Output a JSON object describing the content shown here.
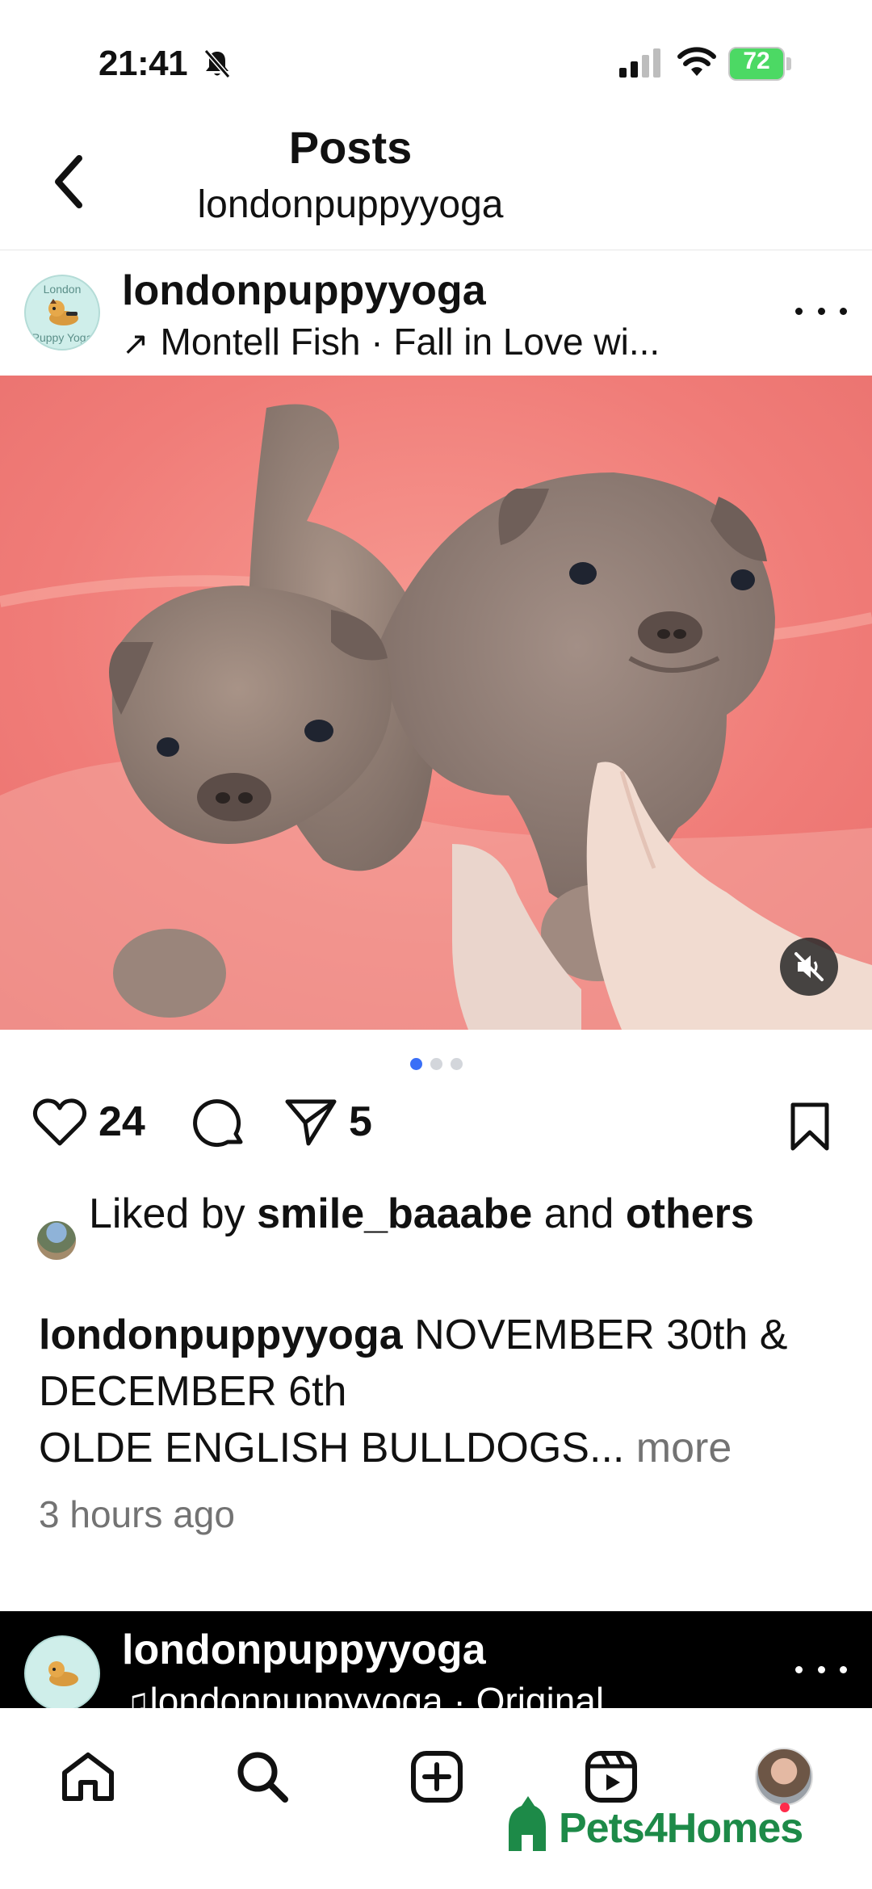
{
  "status_bar": {
    "time": "21:41",
    "battery": "72",
    "icons": [
      "bell-slash-icon",
      "signal-icon",
      "wifi-icon",
      "battery-charging-icon"
    ]
  },
  "header": {
    "title": "Posts",
    "subtitle": "londonpuppyyoga"
  },
  "post": {
    "username": "londonpuppyyoga",
    "audio": "Montell Fish · Fall in Love wi...",
    "avatar_text": [
      "London",
      "Puppy Yoga"
    ],
    "carousel_count": 3,
    "carousel_active": 0,
    "likes_count": "24",
    "shares_count": "5",
    "liked_by_prefix": "Liked by ",
    "liked_by_user": "smile_baaabe",
    "liked_by_middle": " and ",
    "liked_by_others": "others",
    "caption_user": "londonpuppyyoga",
    "caption_line1": "NOVEMBER 30th & DECEMBER 6th",
    "caption_line2": "OLDE ENGLISH BULLDOGS...",
    "caption_more": "more",
    "timestamp": "3 hours ago"
  },
  "next_post": {
    "username": "londonpuppyyoga",
    "audio": "londonpuppyyoga · Original"
  },
  "watermark": {
    "text": "Pets4Homes",
    "color": "#1d8a48"
  },
  "colors": {
    "accent_dot": "#3a6ff7",
    "notification": "#ff2b4b",
    "battery": "#4cd964"
  }
}
